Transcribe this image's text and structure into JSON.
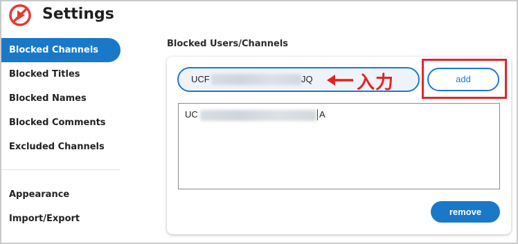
{
  "header": {
    "title": "Settings",
    "logo_icon": "blocked-play-icon",
    "logo_color": "#e53935"
  },
  "sidebar": {
    "primary_items": [
      {
        "label": "Blocked Channels",
        "active": true
      },
      {
        "label": "Blocked Titles",
        "active": false
      },
      {
        "label": "Blocked Names",
        "active": false
      },
      {
        "label": "Blocked Comments",
        "active": false
      },
      {
        "label": "Excluded Channels",
        "active": false
      }
    ],
    "secondary_items": [
      {
        "label": "Appearance"
      },
      {
        "label": "Import/Export"
      }
    ],
    "active_color": "#1a78c9"
  },
  "main": {
    "section_title": "Blocked Users/Channels",
    "input": {
      "prefix": "UCF",
      "suffix": "JQ"
    },
    "add_label": "add",
    "list": [
      {
        "prefix": "UC",
        "suffix": "A"
      }
    ],
    "remove_label": "remove"
  },
  "annotation": {
    "text": "入力",
    "color": "#e82020"
  }
}
